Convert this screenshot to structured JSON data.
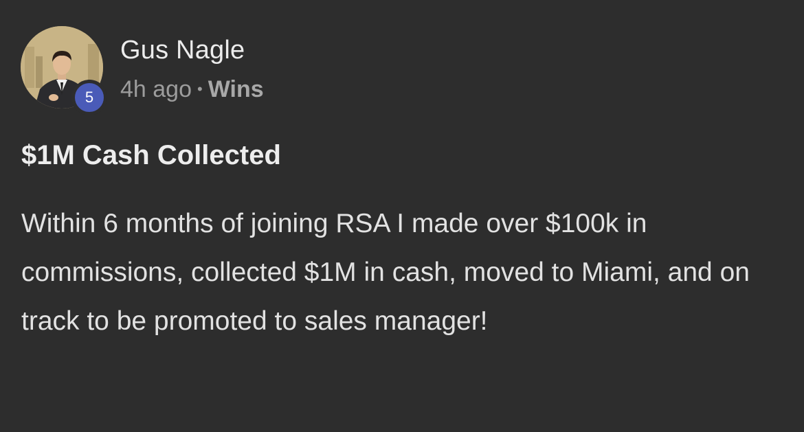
{
  "post": {
    "author": {
      "name": "Gus Nagle",
      "level": "5",
      "avatar_icon": "user-photo"
    },
    "time": "4h ago",
    "separator": "•",
    "category": "Wins",
    "title": "$1M Cash Collected",
    "body": "Within 6 months of joining RSA I made over $100k in commissions, collected $1M in cash, moved to Miami, and on track to be promoted to sales manager!"
  },
  "colors": {
    "background": "#2d2d2d",
    "level_badge": "#4a5bb8",
    "primary_text": "#ececec",
    "secondary_text": "#9c9c9c"
  }
}
